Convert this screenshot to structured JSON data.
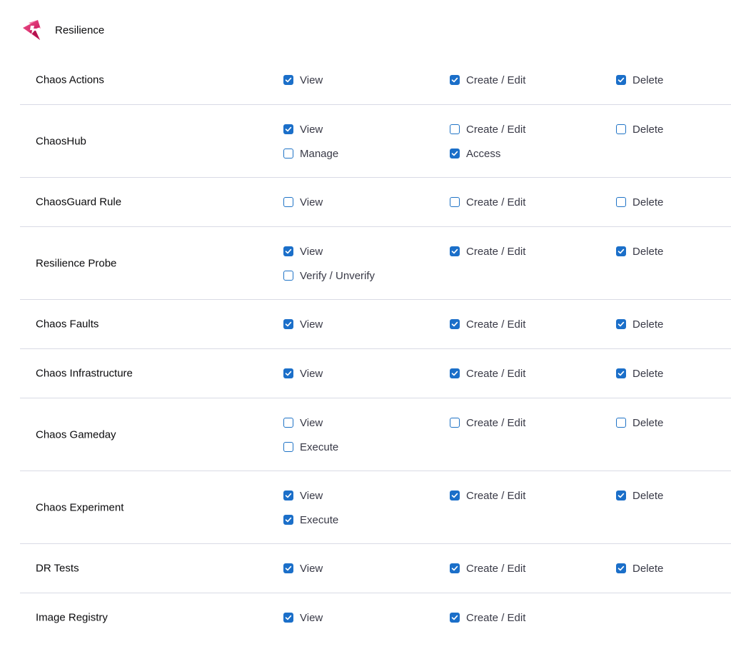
{
  "module": {
    "title": "Resilience",
    "logo_icon": "chaos-module-logo-icon",
    "accent": "#e73c7e"
  },
  "colors": {
    "checkbox": "#1b6fc9",
    "divider": "#d9dae5"
  },
  "resources": [
    {
      "name": "Chaos Actions",
      "permissions": [
        {
          "label": "View",
          "checked": true
        },
        {
          "label": "Create / Edit",
          "checked": true
        },
        {
          "label": "Delete",
          "checked": true
        }
      ]
    },
    {
      "name": "ChaosHub",
      "permissions": [
        {
          "label": "View",
          "checked": true
        },
        {
          "label": "Create / Edit",
          "checked": false
        },
        {
          "label": "Delete",
          "checked": false
        },
        {
          "label": "Manage",
          "checked": false
        },
        {
          "label": "Access",
          "checked": true
        }
      ]
    },
    {
      "name": "ChaosGuard Rule",
      "permissions": [
        {
          "label": "View",
          "checked": false
        },
        {
          "label": "Create / Edit",
          "checked": false
        },
        {
          "label": "Delete",
          "checked": false
        }
      ]
    },
    {
      "name": "Resilience Probe",
      "permissions": [
        {
          "label": "View",
          "checked": true
        },
        {
          "label": "Create / Edit",
          "checked": true
        },
        {
          "label": "Delete",
          "checked": true
        },
        {
          "label": "Verify / Unverify",
          "checked": false
        }
      ]
    },
    {
      "name": "Chaos Faults",
      "permissions": [
        {
          "label": "View",
          "checked": true
        },
        {
          "label": "Create / Edit",
          "checked": true
        },
        {
          "label": "Delete",
          "checked": true
        }
      ]
    },
    {
      "name": "Chaos Infrastructure",
      "permissions": [
        {
          "label": "View",
          "checked": true
        },
        {
          "label": "Create / Edit",
          "checked": true
        },
        {
          "label": "Delete",
          "checked": true
        }
      ]
    },
    {
      "name": "Chaos Gameday",
      "permissions": [
        {
          "label": "View",
          "checked": false
        },
        {
          "label": "Create / Edit",
          "checked": false
        },
        {
          "label": "Delete",
          "checked": false
        },
        {
          "label": "Execute",
          "checked": false
        }
      ]
    },
    {
      "name": "Chaos Experiment",
      "permissions": [
        {
          "label": "View",
          "checked": true
        },
        {
          "label": "Create / Edit",
          "checked": true
        },
        {
          "label": "Delete",
          "checked": true
        },
        {
          "label": "Execute",
          "checked": true
        }
      ]
    },
    {
      "name": "DR Tests",
      "permissions": [
        {
          "label": "View",
          "checked": true
        },
        {
          "label": "Create / Edit",
          "checked": true
        },
        {
          "label": "Delete",
          "checked": true
        }
      ]
    },
    {
      "name": "Image Registry",
      "permissions": [
        {
          "label": "View",
          "checked": true
        },
        {
          "label": "Create / Edit",
          "checked": true
        }
      ]
    }
  ]
}
